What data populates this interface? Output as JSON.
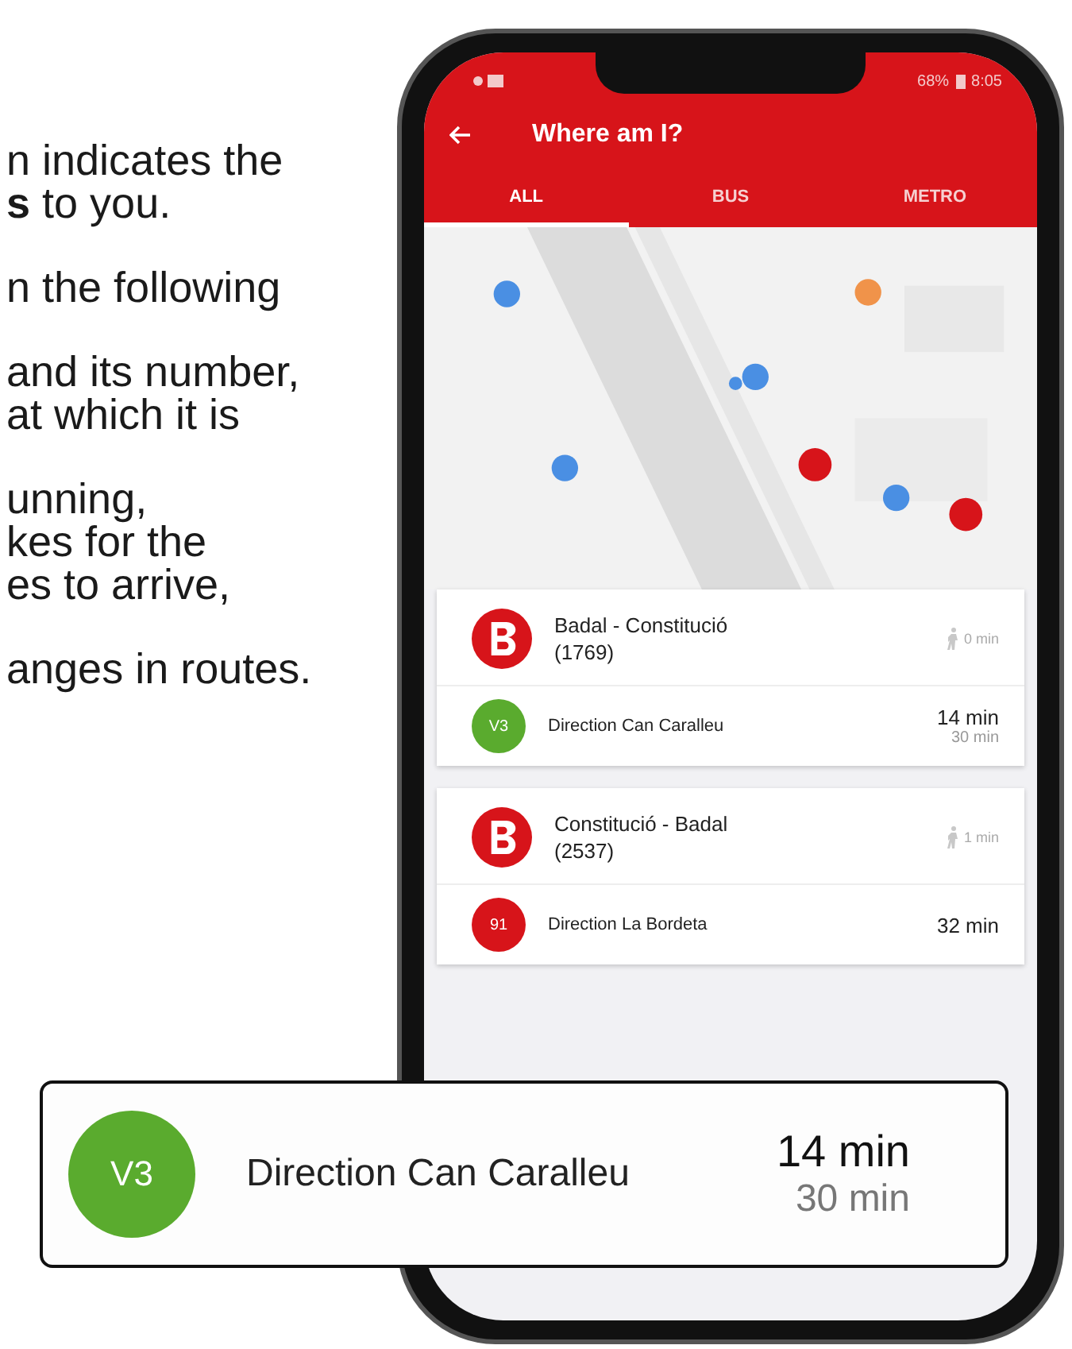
{
  "paragraphs": [
    [
      "n indicates the",
      "**s** to you."
    ],
    [
      "n the following"
    ],
    [
      "and its number,",
      "at which it is"
    ],
    [
      "unning,",
      "kes for the",
      "es to arrive,"
    ],
    [
      "anges in routes."
    ]
  ],
  "phone": {
    "status_bar": {
      "battery": "68%",
      "time": "8:05"
    },
    "title": "Where am I?",
    "tabs": [
      {
        "label": "ALL",
        "selected": true
      },
      {
        "label": "BUS",
        "selected": false
      },
      {
        "label": "METRO",
        "selected": false
      }
    ],
    "stops": [
      {
        "name": "Badal - Constitució",
        "code": "(1769)",
        "walk": "0 min",
        "routes": [
          {
            "line": "V3",
            "color": "#5aab2e",
            "direction": "Direction Can Caralleu",
            "next": "14 min",
            "following": "30 min"
          }
        ]
      },
      {
        "name": "Constitució - Badal",
        "code": "(2537)",
        "walk": "1 min",
        "routes": [
          {
            "line": "91",
            "color": "#d7141a",
            "direction": "Direction La Bordeta",
            "next": "32 min"
          }
        ]
      }
    ]
  },
  "callout": {
    "line": "V3",
    "color": "#5aab2e",
    "direction": "Direction Can Caralleu",
    "next": "14 min",
    "following": "30 min"
  }
}
